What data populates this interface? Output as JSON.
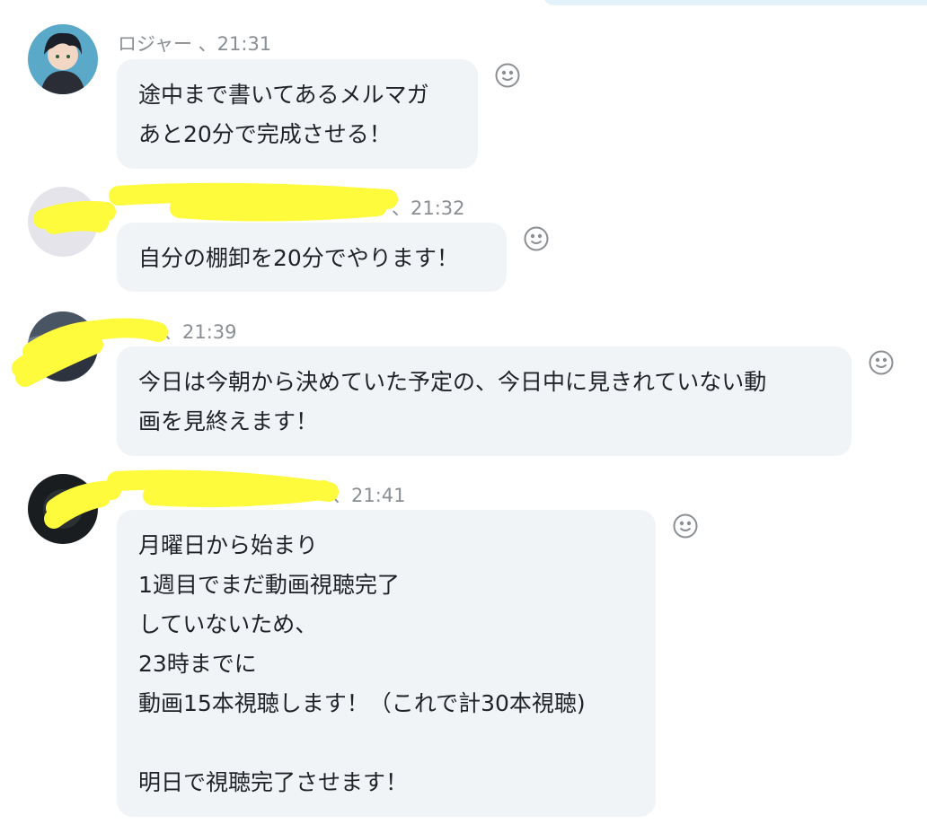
{
  "messages": [
    {
      "sender": "ロジャー",
      "separator": " 、",
      "time": "21:31",
      "lines": [
        "途中まで書いてあるメルマガ",
        "あと20分で完成させる！"
      ]
    },
    {
      "sender": "",
      "separator": "、",
      "time": "21:32",
      "lines": [
        "自分の棚卸を20分でやります！"
      ]
    },
    {
      "sender": "",
      "separator": "、",
      "time": "21:39",
      "lines": [
        "今日は今朝から決めていた予定の、今日中に見きれていない動",
        "画を見終えます！"
      ]
    },
    {
      "sender": "",
      "separator": "、",
      "time": "21:41",
      "lines": [
        "月曜日から始まり",
        "1週目でまだ動画視聴完了",
        "していないため、",
        "23時までに",
        "動画15本視聴します！（これで計30本視聴)",
        "",
        "明日で視聴完了させます！"
      ]
    }
  ],
  "icons": {
    "reaction": "smiley-icon",
    "redaction": "yellow-highlighter-scribble"
  },
  "colors": {
    "bubble": "#f1f4f7",
    "meta_text": "#8a8f94",
    "highlighter": "#fdfb3c",
    "top_bubble": "#e3f2fb"
  }
}
